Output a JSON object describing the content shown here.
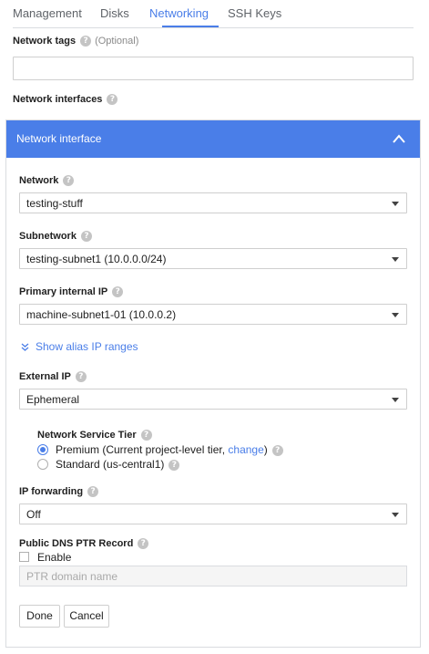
{
  "tabs": [
    {
      "label": "Management",
      "active": false
    },
    {
      "label": "Disks",
      "active": false
    },
    {
      "label": "Networking",
      "active": true
    },
    {
      "label": "SSH Keys",
      "active": false
    }
  ],
  "network_tags": {
    "label": "Network tags",
    "optional": "(Optional)",
    "value": ""
  },
  "network_interfaces": {
    "label": "Network interfaces"
  },
  "panel": {
    "title": "Network interface",
    "network": {
      "label": "Network",
      "value": "testing-stuff"
    },
    "subnetwork": {
      "label": "Subnetwork",
      "value": "testing-subnet1 (10.0.0.0/24)"
    },
    "primary_ip": {
      "label": "Primary internal IP",
      "value": "machine-subnet1-01 (10.0.0.2)"
    },
    "alias_link": "Show alias IP ranges",
    "external_ip": {
      "label": "External IP",
      "value": "Ephemeral"
    },
    "tier": {
      "label": "Network Service Tier",
      "premium_label": "Premium (Current project-level tier, ",
      "premium_link": "change",
      "premium_close": ")",
      "standard_label": "Standard (us-central1)",
      "selected": "premium"
    },
    "ip_forwarding": {
      "label": "IP forwarding",
      "value": "Off"
    },
    "dns": {
      "label": "Public DNS PTR Record",
      "enable_label": "Enable",
      "enabled": false,
      "placeholder": "PTR domain name"
    },
    "done_label": "Done",
    "cancel_label": "Cancel"
  },
  "colors": {
    "accent": "#4a7ee8",
    "help_icon": "#c4c4c4",
    "border": "#cfcfcf"
  },
  "icons": {
    "help": "help-circle-icon",
    "collapse": "chevron-up-icon",
    "expand": "chevron-down-icon",
    "dropdown": "caret-down-icon"
  }
}
